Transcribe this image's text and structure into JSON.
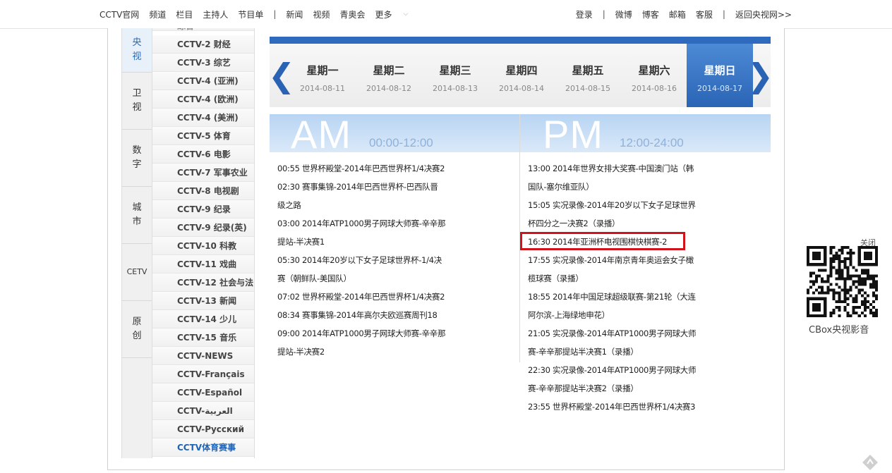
{
  "top_nav": {
    "left": [
      "CCTV官网",
      "频道",
      "栏目",
      "主持人",
      "节目单",
      "|",
      "新闻",
      "视频",
      "青奥会",
      "更多"
    ],
    "right": [
      "登录",
      "|",
      "微博",
      "博客",
      "邮箱",
      "客服",
      "|",
      "返回央视网>>"
    ]
  },
  "categories": [
    {
      "line1": "央",
      "line2": "视"
    },
    {
      "line1": "卫",
      "line2": "视"
    },
    {
      "line1": "数",
      "line2": "字"
    },
    {
      "line1": "城",
      "line2": "市"
    },
    {
      "line1": "CETV",
      "line2": ""
    },
    {
      "line1": "原",
      "line2": "创"
    }
  ],
  "channels": {
    "cut": "综合",
    "items": [
      "CCTV-2 财经",
      "CCTV-3 综艺",
      "CCTV-4 (亚洲)",
      "CCTV-4 (欧洲)",
      "CCTV-4 (美洲)",
      "CCTV-5 体育",
      "CCTV-6 电影",
      "CCTV-7 军事农业",
      "CCTV-8 电视剧",
      "CCTV-9 纪录",
      "CCTV-9 纪录(英)",
      "CCTV-10 科教",
      "CCTV-11 戏曲",
      "CCTV-12 社会与法",
      "CCTV-13 新闻",
      "CCTV-14 少儿",
      "CCTV-15 音乐",
      "CCTV-NEWS",
      "CCTV-Français",
      "CCTV-Español",
      "CCTV-العربية",
      "CCTV-Русский",
      "CCTV体育赛事"
    ],
    "active_index": 22
  },
  "week": {
    "prev": "❮",
    "next": "❯",
    "days": [
      {
        "name": "星期一",
        "date": "2014-08-11"
      },
      {
        "name": "星期二",
        "date": "2014-08-12"
      },
      {
        "name": "星期三",
        "date": "2014-08-13"
      },
      {
        "name": "星期四",
        "date": "2014-08-14"
      },
      {
        "name": "星期五",
        "date": "2014-08-15"
      },
      {
        "name": "星期六",
        "date": "2014-08-16"
      },
      {
        "name": "星期日",
        "date": "2014-08-17"
      }
    ],
    "selected_index": 6
  },
  "am": {
    "label": "AM",
    "range": "00:00-12:00",
    "lines": [
      "00:55 世界杯殿堂-2014年巴西世界杯1/4决赛2",
      "02:30 赛事集锦-2014年巴西世界杯-巴西队晋",
      "级之路",
      "03:00 2014年ATP1000男子网球大师赛-辛辛那",
      "提站-半决赛1",
      "05:30 2014年20岁以下女子足球世界杯-1/4决",
      "赛（朝鲜队-美国队）",
      "07:02 世界杯殿堂-2014年巴西世界杯1/4决赛2",
      "08:34 赛事集锦-2014年高尔夫欧巡赛周刊18",
      "09:00 2014年ATP1000男子网球大师赛-辛辛那",
      "提站-半决赛2"
    ]
  },
  "pm": {
    "label": "PM",
    "range": "12:00-24:00",
    "lines": [
      "13:00 2014年世界女排大奖赛-中国澳门站（韩",
      "国队-塞尔维亚队）",
      "15:05 实况录像-2014年20岁以下女子足球世界",
      "杯四分之一决赛2（录播）",
      "16:30 2014年亚洲杯电视围棋快棋赛-2",
      "17:55 实况录像-2014年南京青年奥运会女子橄",
      "榄球赛（录播）",
      "18:55 2014年中国足球超级联赛-第21轮（大连",
      "阿尔滨-上海绿地申花）",
      "21:05 实况录像-2014年ATP1000男子网球大师",
      "赛-辛辛那提站半决赛1（录播）",
      "22:30 实况录像-2014年ATP1000男子网球大师",
      "赛-辛辛那提站半决赛2（录播）",
      "23:55 世界杯殿堂-2014年巴西世界杯1/4决赛3"
    ],
    "highlight_index": 4
  },
  "qr": {
    "close": "关闭",
    "label": "CBox央视影音"
  }
}
